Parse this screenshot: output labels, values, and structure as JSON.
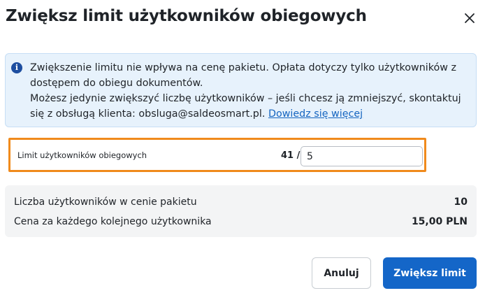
{
  "dialog": {
    "title": "Zwiększ limit użytkowników obiegowych"
  },
  "info": {
    "line1": "Zwiększenie limitu nie wpływa na cenę pakietu. Opłata dotyczy tylko użytkowników z dostępem do obiegu dokumentów.",
    "line2": "Możesz jedynie zwiększyć liczbę użytkowników – jeśli chcesz ją zmniejszyć, skontaktuj się z obsługą klienta: obsluga@saldeosmart.pl.",
    "link": "Dowiedz się więcej"
  },
  "limit": {
    "label": "Limit użytkowników obiegowych",
    "current": "41 /",
    "input_value": "5"
  },
  "pricing": {
    "users_label": "Liczba użytkowników w cenie pakietu",
    "users_value": "10",
    "price_label": "Cena za każdego kolejnego użytkownika",
    "price_value": "15,00 PLN"
  },
  "buttons": {
    "cancel": "Anuluj",
    "confirm": "Zwiększ limit"
  },
  "colors": {
    "primary": "#1466c8",
    "highlight": "#f08a1c",
    "info_bg": "#e7f2fc"
  }
}
